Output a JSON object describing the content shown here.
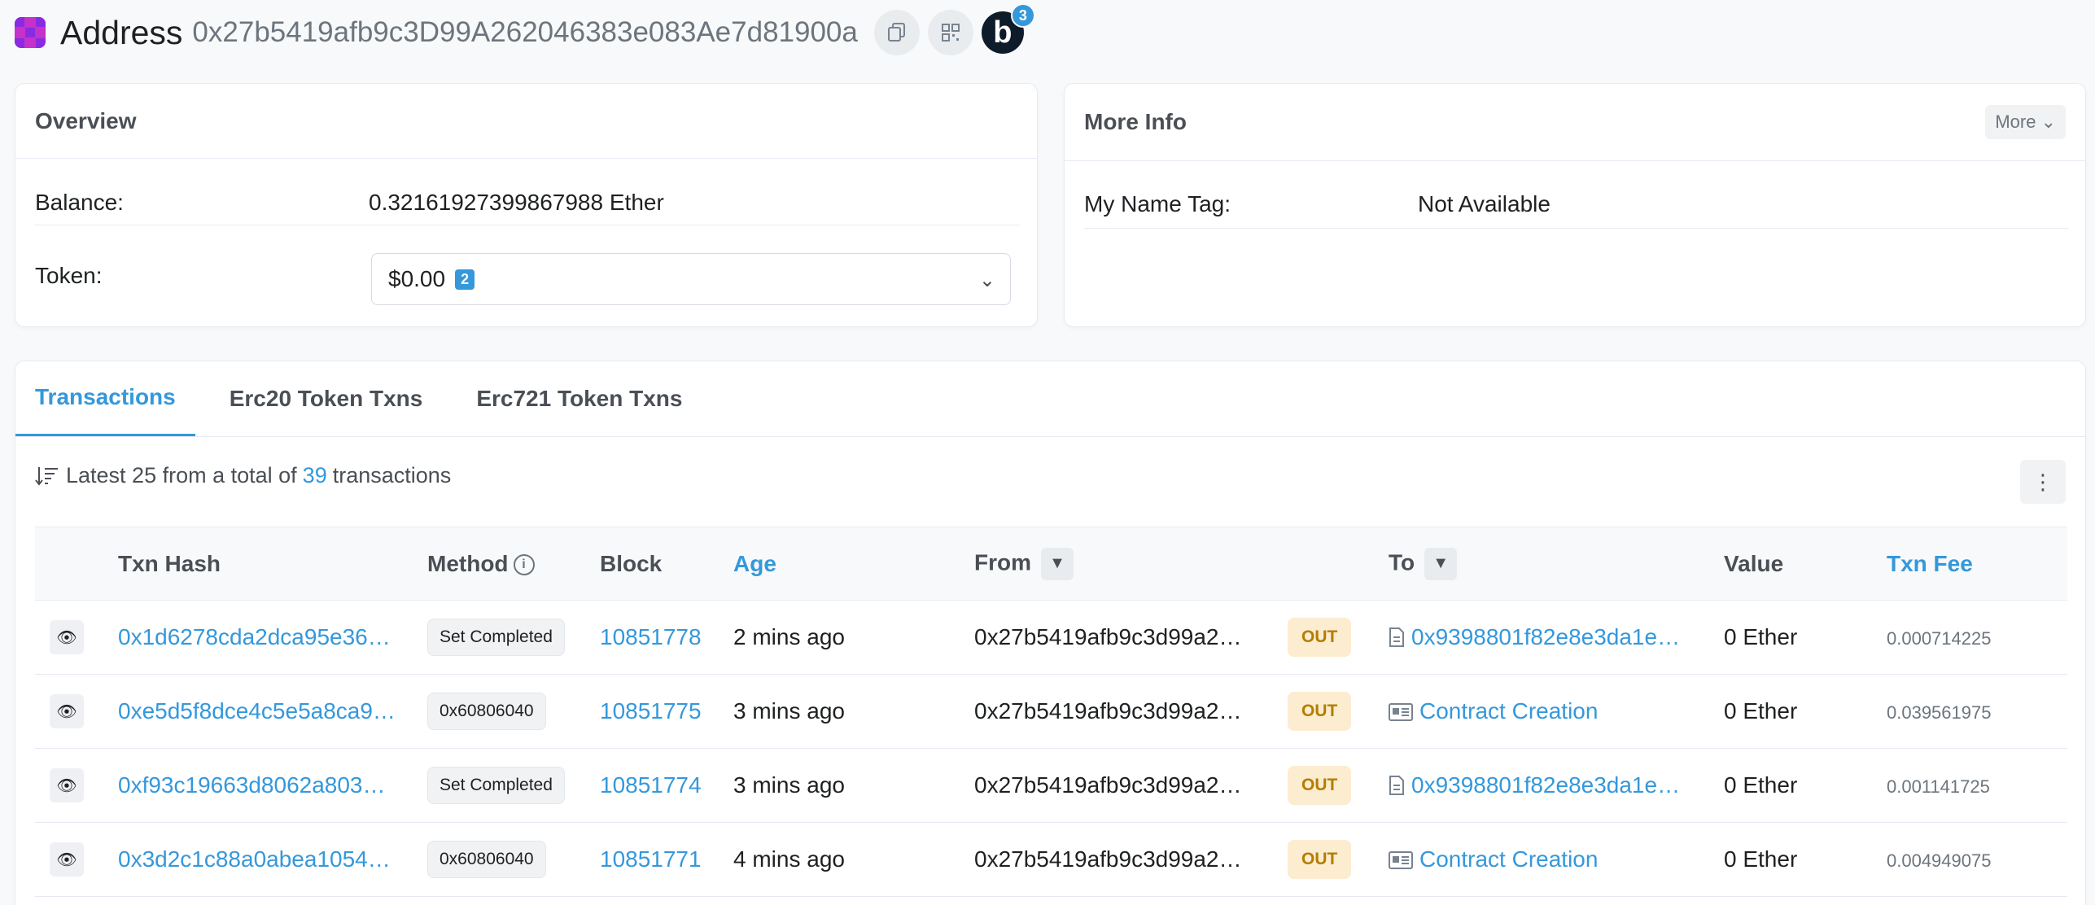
{
  "header": {
    "title": "Address",
    "address": "0x27b5419afb9c3D99A262046383e083Ae7d81900a",
    "blockscan_letter": "b",
    "blockscan_badge": "3"
  },
  "overview": {
    "title": "Overview",
    "balance_label": "Balance:",
    "balance_value": "0.32161927399867988 Ether",
    "token_label": "Token:",
    "token_value": "$0.00",
    "token_count": "2"
  },
  "more_info": {
    "title": "More Info",
    "more_button": "More",
    "name_tag_label": "My Name Tag:",
    "name_tag_value": "Not Available"
  },
  "tabs": [
    {
      "label": "Transactions",
      "active": true
    },
    {
      "label": "Erc20 Token Txns",
      "active": false
    },
    {
      "label": "Erc721 Token Txns",
      "active": false
    }
  ],
  "summary": {
    "prefix": "Latest 25 from a total of",
    "total": "39",
    "suffix": "transactions"
  },
  "table": {
    "headers": {
      "txn_hash": "Txn Hash",
      "method": "Method",
      "block": "Block",
      "age": "Age",
      "from": "From",
      "to": "To",
      "value": "Value",
      "txn_fee": "Txn Fee"
    },
    "rows": [
      {
        "hash": "0x1d6278cda2dca95e36…",
        "method": "Set Completed",
        "block": "10851778",
        "age": "2 mins ago",
        "from": "0x27b5419afb9c3d99a2…",
        "direction": "OUT",
        "to_icon": "contract-file-icon",
        "to": "0x9398801f82e8e3da1e…",
        "value": "0 Ether",
        "fee": "0.000714225"
      },
      {
        "hash": "0xe5d5f8dce4c5e5a8ca9…",
        "method": "0x60806040",
        "block": "10851775",
        "age": "3 mins ago",
        "from": "0x27b5419afb9c3d99a2…",
        "direction": "OUT",
        "to_icon": "contract-creation-icon",
        "to": "Contract Creation",
        "value": "0 Ether",
        "fee": "0.039561975"
      },
      {
        "hash": "0xf93c19663d8062a803…",
        "method": "Set Completed",
        "block": "10851774",
        "age": "3 mins ago",
        "from": "0x27b5419afb9c3d99a2…",
        "direction": "OUT",
        "to_icon": "contract-file-icon",
        "to": "0x9398801f82e8e3da1e…",
        "value": "0 Ether",
        "fee": "0.001141725"
      },
      {
        "hash": "0x3d2c1c88a0abea1054…",
        "method": "0x60806040",
        "block": "10851771",
        "age": "4 mins ago",
        "from": "0x27b5419afb9c3d99a2…",
        "direction": "OUT",
        "to_icon": "contract-creation-icon",
        "to": "Contract Creation",
        "value": "0 Ether",
        "fee": "0.004949075"
      }
    ]
  },
  "colors": {
    "accent": "#3498db",
    "out_badge_bg": "#fcecd0",
    "out_badge_text": "#b47d00",
    "avatar": "#c531c9"
  }
}
